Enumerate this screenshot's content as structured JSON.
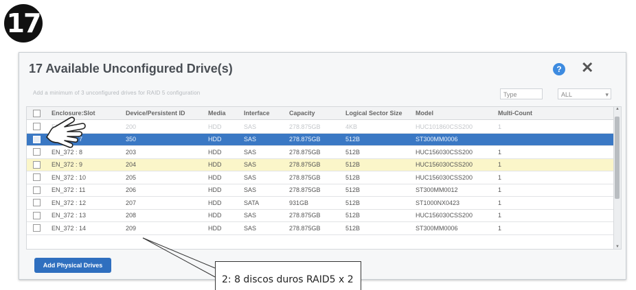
{
  "step_number": "17",
  "dialog": {
    "title": "17 Available Unconfigured Drive(s)",
    "help_icon": "question-circle-icon",
    "close_icon": "close-icon",
    "hint": "Add a minimum of 3 unconfigured drives for RAID 5 configuration",
    "filter_label": "Type",
    "filter_value": "ALL"
  },
  "grid": {
    "columns": [
      "",
      "Enclosure:Slot",
      "Device/Persistent ID",
      "Media",
      "Interface",
      "Capacity",
      "Logical Sector Size",
      "Model",
      "Multi-Count"
    ],
    "rows": [
      {
        "slot": "EN_372 : 6",
        "id": "200",
        "media": "HDD",
        "iface": "SAS",
        "capacity": "278.875GB",
        "sector": "4KB",
        "model": "HUC101860CSS200",
        "count": "1",
        "style": "faded"
      },
      {
        "slot": "EN_372 : 7",
        "id": "350",
        "media": "HDD",
        "iface": "SAS",
        "capacity": "278.875GB",
        "sector": "512B",
        "model": "ST300MM0006",
        "count": "",
        "style": "selected"
      },
      {
        "slot": "EN_372 : 8",
        "id": "203",
        "media": "HDD",
        "iface": "SAS",
        "capacity": "278.875GB",
        "sector": "512B",
        "model": "HUC156030CSS200",
        "count": "1",
        "style": "normal"
      },
      {
        "slot": "EN_372 : 9",
        "id": "204",
        "media": "HDD",
        "iface": "SAS",
        "capacity": "278.875GB",
        "sector": "512B",
        "model": "HUC156030CSS200",
        "count": "1",
        "style": "highlight"
      },
      {
        "slot": "EN_372 : 10",
        "id": "205",
        "media": "HDD",
        "iface": "SAS",
        "capacity": "278.875GB",
        "sector": "512B",
        "model": "HUC156030CSS200",
        "count": "1",
        "style": "normal"
      },
      {
        "slot": "EN_372 : 11",
        "id": "206",
        "media": "HDD",
        "iface": "SAS",
        "capacity": "278.875GB",
        "sector": "512B",
        "model": "ST300MM0012",
        "count": "1",
        "style": "normal"
      },
      {
        "slot": "EN_372 : 12",
        "id": "207",
        "media": "HDD",
        "iface": "SATA",
        "capacity": "931GB",
        "sector": "512B",
        "model": "ST1000NX0423",
        "count": "1",
        "style": "normal"
      },
      {
        "slot": "EN_372 : 13",
        "id": "208",
        "media": "HDD",
        "iface": "SAS",
        "capacity": "278.875GB",
        "sector": "512B",
        "model": "HUC156030CSS200",
        "count": "1",
        "style": "normal"
      },
      {
        "slot": "EN_372 : 14",
        "id": "209",
        "media": "HDD",
        "iface": "SAS",
        "capacity": "278.875GB",
        "sector": "512B",
        "model": "ST300MM0006",
        "count": "1",
        "style": "normal"
      }
    ]
  },
  "add_button_label": "Add Physical Drives",
  "callout_text": "2: 8 discos duros RAID5 x 2",
  "pointer_icon": "pointing-hand-icon",
  "colors": {
    "selected_row": "#3a78c4",
    "highlight_row": "#fbf6c9",
    "button": "#2f6fbf"
  }
}
